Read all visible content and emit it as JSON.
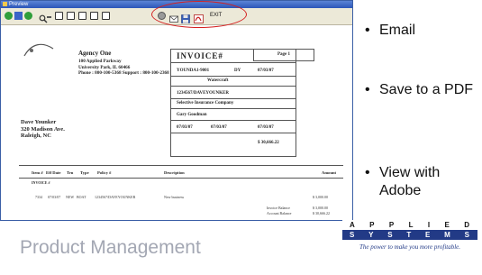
{
  "window": {
    "title": "Preview",
    "exit_label": "EXIT"
  },
  "invoice": {
    "agency_name": "Agency One",
    "agency_address": [
      "100 Applied Parkway",
      "University Park, IL  60466",
      "Phone : 800-100-5368   Support : 800-100-2368"
    ],
    "title": "INVOICE#",
    "page": "Page 1",
    "invoice_no": "YOUNDA1-9001",
    "invoice_code": "DY",
    "invoice_date": "07/03/07",
    "company": "Watercraft",
    "policy_ref": "1234567/DAVEYOUNKER",
    "insurer": "Selective Insurance Company",
    "producer": "Gary Goodman",
    "effective": "07/03/07",
    "expiration": "07/03/07",
    "balance_due": "07/03/07",
    "amount": "$     30,666.22",
    "customer": [
      "Dave Younker",
      "320 Madison Ave.",
      "Raleigh, NC"
    ],
    "columns": [
      "Item #",
      "Eff Date",
      "Trn",
      "Type",
      "Policy #",
      "Description",
      "Amount"
    ],
    "section": "INVOICE #",
    "row": {
      "item": "7334",
      "date": "07/03/07",
      "trn": "NEW",
      "type": "BOAT",
      "policy": "1234567/DAVEYOUNKER",
      "description": "New business",
      "amount": "$       3,000.00"
    },
    "totals": [
      {
        "label": "Invoice Balance",
        "value": "$       3,000.00"
      },
      {
        "label": "Account Balance",
        "value": "$     30,666.22"
      }
    ]
  },
  "bullets": [
    "Email",
    "Save to a PDF",
    "View with Adobe"
  ],
  "footer": {
    "product_management": "Product Management"
  },
  "applied_logo": {
    "row1": [
      "A",
      "P",
      "P",
      "L",
      "I",
      "E",
      "D"
    ],
    "row2": [
      "S",
      "Y",
      "S",
      "T",
      "E",
      "M",
      "S"
    ],
    "tagline": "The power to make you more profitable."
  },
  "colors": {
    "title_bar": "#2c56b8",
    "highlight": "#d42020",
    "brand_blue": "#223a86",
    "muted_text": "#a3a7b3"
  }
}
